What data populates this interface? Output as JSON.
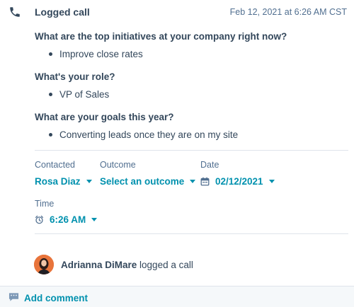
{
  "header": {
    "title": "Logged call",
    "timestamp": "Feb 12, 2021 at 6:26 AM CST",
    "icon": "phone-icon"
  },
  "questions": [
    {
      "question": "What are the top initiatives at your company right now?",
      "answer": "Improve close rates"
    },
    {
      "question": "What's your role?",
      "answer": "VP of Sales"
    },
    {
      "question": "What are your goals this year?",
      "answer": "Converting leads once they are on my site"
    }
  ],
  "fields": {
    "contacted": {
      "label": "Contacted",
      "value": "Rosa Diaz"
    },
    "outcome": {
      "label": "Outcome",
      "value": "Select an outcome"
    },
    "date": {
      "label": "Date",
      "value": "02/12/2021",
      "icon": "calendar-icon"
    },
    "time": {
      "label": "Time",
      "value": "6:26 AM",
      "icon": "alarm-clock-icon"
    }
  },
  "activity": {
    "user": "Adrianna DiMare",
    "action": "logged a call"
  },
  "footer": {
    "add_comment": "Add comment",
    "icon": "comment-icon"
  },
  "colors": {
    "text": "#33475b",
    "secondary": "#516f90",
    "link": "#0091ae",
    "divider": "#dfe3eb",
    "footer_bg": "#f5f8fa"
  }
}
